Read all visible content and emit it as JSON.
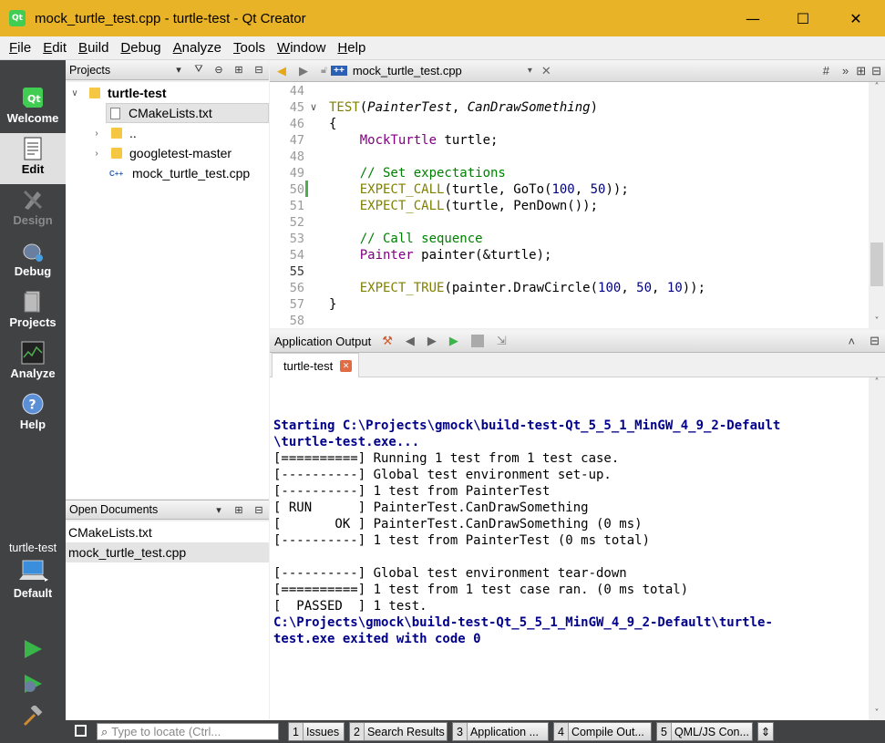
{
  "window": {
    "title": "mock_turtle_test.cpp - turtle-test - Qt Creator",
    "app_icon": "Qt",
    "minimize": "—",
    "maximize": "☐",
    "close": "✕"
  },
  "menu": [
    "File",
    "Edit",
    "Build",
    "Debug",
    "Analyze",
    "Tools",
    "Window",
    "Help"
  ],
  "modes": [
    {
      "label": "Welcome",
      "icon": "qt-logo-icon",
      "state": "normal"
    },
    {
      "label": "Edit",
      "icon": "edit-document-icon",
      "state": "active"
    },
    {
      "label": "Design",
      "icon": "design-pencil-icon",
      "state": "disabled"
    },
    {
      "label": "Debug",
      "icon": "bug-icon",
      "state": "normal"
    },
    {
      "label": "Projects",
      "icon": "projects-icon",
      "state": "normal"
    },
    {
      "label": "Analyze",
      "icon": "analyze-icon",
      "state": "normal"
    },
    {
      "label": "Help",
      "icon": "help-icon",
      "state": "normal"
    }
  ],
  "projects": {
    "header": "Projects",
    "tree": [
      {
        "label": "turtle-test",
        "indent": 0,
        "arrow": "∨",
        "type": "folder",
        "bold": true
      },
      {
        "label": "CMakeLists.txt",
        "indent": 1,
        "arrow": "",
        "type": "file",
        "selected": true
      },
      {
        "label": "..",
        "indent": 1,
        "arrow": "›",
        "type": "folder"
      },
      {
        "label": "googletest-master",
        "indent": 1,
        "arrow": "›",
        "type": "folder"
      },
      {
        "label": "mock_turtle_test.cpp",
        "indent": 1,
        "arrow": "",
        "type": "cpp",
        "cpp_badge": "C++"
      }
    ]
  },
  "open_documents": {
    "header": "Open Documents",
    "items": [
      "CMakeLists.txt",
      "mock_turtle_test.cpp"
    ],
    "selected": 1
  },
  "kit": {
    "project": "turtle-test",
    "build": "Default"
  },
  "editor": {
    "file_tab": "mock_turtle_test.cpp",
    "hash": "#",
    "more": "»",
    "lines": [
      {
        "n": "44",
        "fold": "",
        "code": ""
      },
      {
        "n": "45",
        "fold": "∨",
        "code": "TEST(PainterTest, CanDrawSomething)"
      },
      {
        "n": "46",
        "fold": "",
        "code": "{"
      },
      {
        "n": "47",
        "fold": "",
        "code": "    MockTurtle turtle;"
      },
      {
        "n": "48",
        "fold": "",
        "code": ""
      },
      {
        "n": "49",
        "fold": "",
        "code": "    // Set expectations"
      },
      {
        "n": "50",
        "fold": "",
        "code": "    EXPECT_CALL(turtle, GoTo(100, 50));"
      },
      {
        "n": "51",
        "fold": "",
        "code": "    EXPECT_CALL(turtle, PenDown());"
      },
      {
        "n": "52",
        "fold": "",
        "code": ""
      },
      {
        "n": "53",
        "fold": "",
        "code": "    // Call sequence"
      },
      {
        "n": "54",
        "fold": "",
        "code": "    Painter painter(&turtle);"
      },
      {
        "n": "55",
        "fold": "",
        "code": ""
      },
      {
        "n": "56",
        "fold": "",
        "code": "    EXPECT_TRUE(painter.DrawCircle(100, 50, 10));"
      },
      {
        "n": "57",
        "fold": "",
        "code": "}"
      },
      {
        "n": "58",
        "fold": "",
        "code": ""
      }
    ]
  },
  "output": {
    "header": "Application Output",
    "tab": "turtle-test",
    "lines": [
      {
        "t": "",
        "hl": false
      },
      {
        "t": "",
        "hl": false
      },
      {
        "t": "Starting C:\\Projects\\gmock\\build-test-Qt_5_5_1_MinGW_4_9_2-Default",
        "hl": true
      },
      {
        "t": "\\turtle-test.exe...",
        "hl": true
      },
      {
        "t": "[==========] Running 1 test from 1 test case.",
        "hl": false
      },
      {
        "t": "[----------] Global test environment set-up.",
        "hl": false
      },
      {
        "t": "[----------] 1 test from PainterTest",
        "hl": false
      },
      {
        "t": "[ RUN      ] PainterTest.CanDrawSomething",
        "hl": false
      },
      {
        "t": "[       OK ] PainterTest.CanDrawSomething (0 ms)",
        "hl": false
      },
      {
        "t": "[----------] 1 test from PainterTest (0 ms total)",
        "hl": false
      },
      {
        "t": "",
        "hl": false
      },
      {
        "t": "[----------] Global test environment tear-down",
        "hl": false
      },
      {
        "t": "[==========] 1 test from 1 test case ran. (0 ms total)",
        "hl": false
      },
      {
        "t": "[  PASSED  ] 1 test.",
        "hl": false
      },
      {
        "t": "C:\\Projects\\gmock\\build-test-Qt_5_5_1_MinGW_4_9_2-Default\\turtle-",
        "hl": true
      },
      {
        "t": "test.exe exited with code 0",
        "hl": true
      }
    ]
  },
  "statusbar": {
    "locate_placeholder": "Type to locate (Ctrl...",
    "panes": [
      {
        "n": "1",
        "label": "Issues"
      },
      {
        "n": "2",
        "label": "Search Results"
      },
      {
        "n": "3",
        "label": "Application ..."
      },
      {
        "n": "4",
        "label": "Compile Out..."
      },
      {
        "n": "5",
        "label": "QML/JS Con..."
      }
    ]
  },
  "colors": {
    "titlebar": "#e8b326",
    "modebar": "#404244",
    "keyword": "#808000",
    "type": "#800080",
    "comment": "#008000",
    "number": "#000080",
    "output_highlight": "#00008b"
  }
}
